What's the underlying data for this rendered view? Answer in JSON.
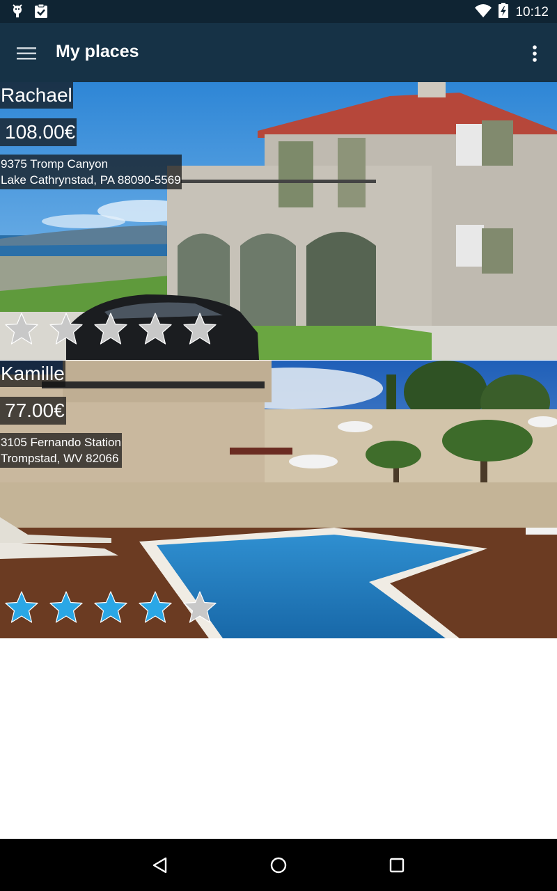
{
  "status_bar": {
    "time": "10:12",
    "icons": [
      "android-debug-icon",
      "clipboard-check-icon",
      "wifi-icon",
      "battery-charging-icon"
    ]
  },
  "app_bar": {
    "title": "My places",
    "menu_icon": "hamburger-menu-icon",
    "overflow_icon": "overflow-menu-icon"
  },
  "places": [
    {
      "name": "Rachael",
      "price": "108.00€",
      "address_line1": "9375 Tromp Canyon",
      "address_line2": "Lake Cathrynstad, PA 88090-5569",
      "rating": 0,
      "max_rating": 5
    },
    {
      "name": "Kamille",
      "price": "77.00€",
      "address_line1": "3105 Fernando Station",
      "address_line2": "Trompstad, WV 82066",
      "rating": 4,
      "max_rating": 5
    }
  ],
  "colors": {
    "status_bar": "#0f2433",
    "app_bar": "#163246",
    "star_filled": "#2aa7e6",
    "star_empty": "#c8c8c8"
  },
  "nav_bar": {
    "icons": [
      "back-icon",
      "home-icon",
      "recents-icon"
    ]
  }
}
